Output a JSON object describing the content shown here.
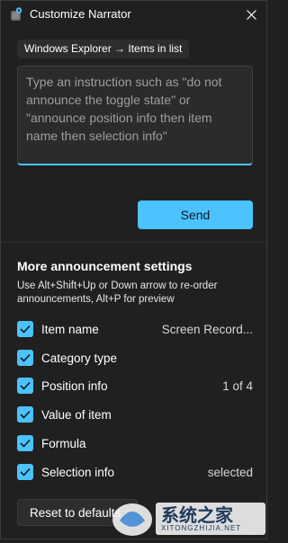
{
  "window": {
    "title": "Customize Narrator"
  },
  "context": {
    "label": "Windows Explorer → Items in list"
  },
  "instruction": {
    "placeholder": "Type an instruction such as \"do not announce the toggle state\" or \"announce position info then item name then selection info\""
  },
  "send_label": "Send",
  "announcement_settings": {
    "heading": "More announcement settings",
    "description": "Use Alt+Shift+Up or Down arrow to re-order announcements, Alt+P for preview",
    "items": [
      {
        "label": "Item name",
        "value": "Screen Record...",
        "checked": true
      },
      {
        "label": "Category type",
        "value": "",
        "checked": true
      },
      {
        "label": "Position info",
        "value": "1 of 4",
        "checked": true
      },
      {
        "label": "Value of item",
        "value": "",
        "checked": true
      },
      {
        "label": "Formula",
        "value": "",
        "checked": true
      },
      {
        "label": "Selection info",
        "value": "selected",
        "checked": true
      }
    ]
  },
  "reset_label": "Reset to defaults",
  "watermark": {
    "text": "系统之家",
    "url": "XITONGZHIJIA.NET"
  },
  "colors": {
    "accent": "#4cc2ff",
    "background": "#202020"
  }
}
